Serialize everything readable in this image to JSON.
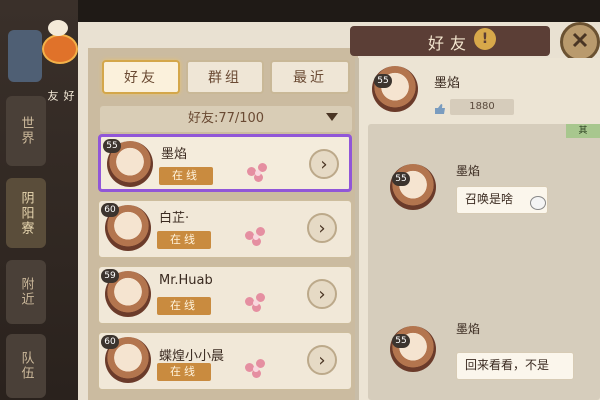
{
  "side_tabs": [
    "世界",
    "阴阳寮",
    "附近",
    "队伍"
  ],
  "mascot_label": "好友",
  "header": {
    "title": "好友",
    "help_icon": "!"
  },
  "tabs": [
    {
      "label": "好友",
      "active": true
    },
    {
      "label": "群组",
      "active": false
    },
    {
      "label": "最近",
      "active": false
    }
  ],
  "friend_count": "好友:77/100",
  "friends": [
    {
      "level": "55",
      "name": "墨焰",
      "status": "在线",
      "selected": true
    },
    {
      "level": "60",
      "name": "白芷·",
      "status": "在线",
      "selected": false
    },
    {
      "level": "59",
      "name": "Mr.Huab",
      "status": "在线",
      "selected": false
    },
    {
      "level": "60",
      "name": "蝶煌小小晨",
      "status": "在线",
      "selected": false
    }
  ],
  "chat": {
    "partner": {
      "level": "55",
      "name": "墨焰",
      "likes": "1880"
    },
    "badge": "其",
    "messages": [
      {
        "level": "55",
        "name": "墨焰",
        "text": "召唤是啥"
      },
      {
        "level": "55",
        "name": "墨焰",
        "text": "回来看看，不是"
      }
    ]
  }
}
